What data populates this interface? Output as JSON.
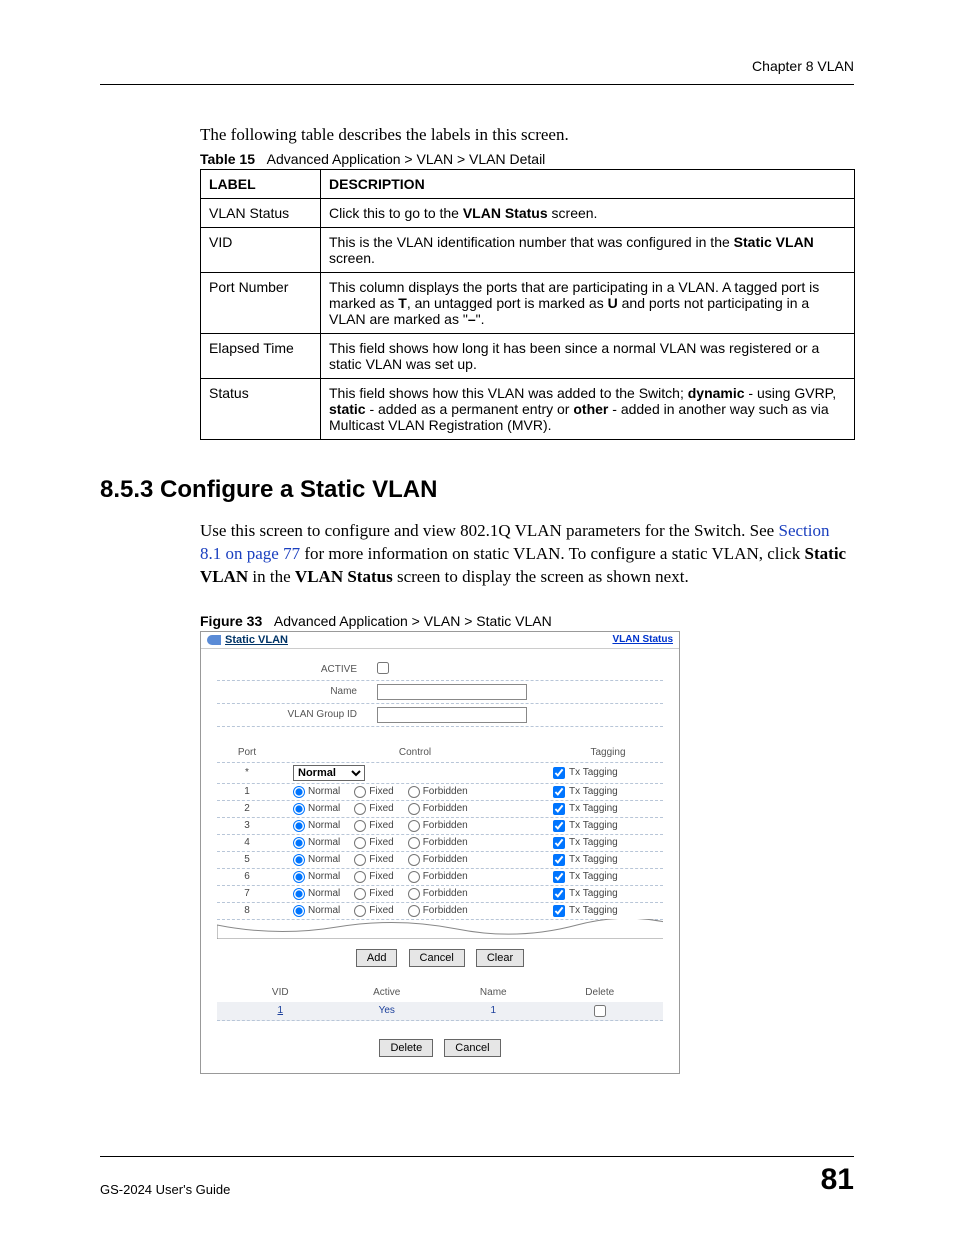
{
  "header": {
    "chapter": "Chapter 8 VLAN"
  },
  "intro": "The following table describes the labels in this screen.",
  "table_caption": {
    "num": "Table 15",
    "text": "Advanced Application > VLAN > VLAN Detail"
  },
  "table": {
    "headers": {
      "label": "LABEL",
      "description": "DESCRIPTION"
    },
    "rows": [
      {
        "label": "VLAN Status",
        "desc_pre": "Click this to go to the ",
        "desc_b1": "VLAN Status",
        "desc_post": " screen."
      },
      {
        "label": "VID",
        "desc_pre": "This is the VLAN identification number that was configured in the ",
        "desc_b1": "Static VLAN",
        "desc_post": " screen."
      },
      {
        "label": "Port Number",
        "desc_pre": "This column displays the ports that are participating in a VLAN. A tagged port is marked as ",
        "desc_b1": "T",
        "desc_mid1": ", an untagged port is marked as ",
        "desc_b2": "U",
        "desc_mid2": " and ports not participating in a VLAN are marked as \"",
        "desc_b3": "–",
        "desc_post": "\"."
      },
      {
        "label": "Elapsed Time",
        "desc_plain": "This field shows how long it has been since a normal VLAN was registered or a static VLAN was set up."
      },
      {
        "label": "Status",
        "desc_pre": "This field shows how this VLAN was added to the Switch; ",
        "desc_b1": "dynamic",
        "desc_mid1": " - using GVRP, ",
        "desc_b2": "static",
        "desc_mid2": " - added as a permanent entry or ",
        "desc_b3": "other",
        "desc_post": " - added in another way such as via Multicast VLAN Registration (MVR)."
      }
    ]
  },
  "section": {
    "heading": "8.5.3  Configure a Static VLAN",
    "body_pre": "Use this screen to configure and view 802.1Q VLAN parameters for the Switch. See ",
    "body_link": "Section 8.1 on page 77",
    "body_mid": " for more information on static VLAN. To configure a static VLAN, click ",
    "body_b1": "Static VLAN",
    "body_mid2": " in the ",
    "body_b2": "VLAN Status",
    "body_post": " screen to display the screen as shown next."
  },
  "figure_caption": {
    "num": "Figure 33",
    "text": "Advanced Application > VLAN > Static VLAN"
  },
  "figure": {
    "title": "Static VLAN",
    "title_link": "VLAN Status",
    "fields": {
      "active": "ACTIVE",
      "name": "Name",
      "groupid": "VLAN Group ID"
    },
    "port_head": {
      "port": "Port",
      "control": "Control",
      "tag": "Tagging"
    },
    "star_row": {
      "port": "*",
      "select": "Normal",
      "tag_label": "Tx Tagging"
    },
    "labels": {
      "normal": "Normal",
      "fixed": "Fixed",
      "forbidden": "Forbidden",
      "txtag": "Tx Tagging"
    },
    "ports": [
      "1",
      "2",
      "3",
      "4",
      "5",
      "6",
      "7",
      "8"
    ],
    "buttons": {
      "add": "Add",
      "cancel": "Cancel",
      "clear": "Clear",
      "delete": "Delete"
    },
    "lower_head": {
      "vid": "VID",
      "active": "Active",
      "name": "Name",
      "delete": "Delete"
    },
    "lower_row": {
      "vid": "1",
      "active": "Yes",
      "name": "1"
    }
  },
  "footer": {
    "guide": "GS-2024 User's Guide",
    "page": "81"
  }
}
